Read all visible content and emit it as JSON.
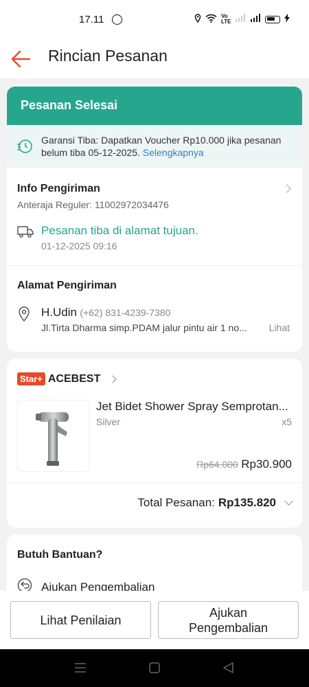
{
  "status_bar": {
    "time": "17.11",
    "indicator_text": "Vo LTE"
  },
  "header": {
    "title": "Rincian Pesanan"
  },
  "order_status": {
    "title": "Pesanan Selesai",
    "guarantee_text": "Garansi Tiba: Dapatkan Voucher Rp10.000 jika pesanan belum tiba 05-12-2025.",
    "guarantee_link": "Selengkapnya"
  },
  "shipping_info": {
    "title": "Info Pengiriman",
    "courier": "Anteraja Reguler: 11002972034476",
    "status": "Pesanan tiba di alamat tujuan.",
    "timestamp": "01-12-2025 09:16"
  },
  "address": {
    "title": "Alamat Pengiriman",
    "name": "H.Udin",
    "phone": "(+62) 831-4239-7380",
    "detail": "Jl.Tirta Dharma simp.PDAM jalur pintu air 1 no...",
    "view_label": "Lihat"
  },
  "shop": {
    "badge": "Star+",
    "name": "ACEBEST"
  },
  "product": {
    "name": "Jet Bidet Shower Spray  Semprotan...",
    "variant": "Silver",
    "quantity": "x5",
    "original_price": "Rp64.000",
    "price": "Rp30.900"
  },
  "order_total": {
    "label": "Total Pesanan:",
    "value": "Rp135.820"
  },
  "help": {
    "title": "Butuh Bantuan?",
    "return_item": "Ajukan Pengembalian"
  },
  "actions": {
    "review_label": "Lihat Penilaian",
    "return_label": "Ajukan\nPengembalian"
  },
  "colors": {
    "accent_green": "#26a68c",
    "brand_orange": "#e8492b",
    "link_blue": "#2f80c7"
  }
}
